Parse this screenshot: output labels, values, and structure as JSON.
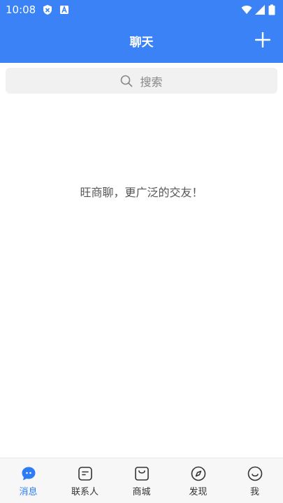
{
  "status_bar": {
    "time": "10:08",
    "icons": [
      "shield-notification-icon",
      "a-notification-icon",
      "wifi-icon",
      "signal-icon",
      "battery-icon"
    ]
  },
  "header": {
    "title": "聊天",
    "add_icon": "plus-icon",
    "background_color": "#3a82f6"
  },
  "search": {
    "placeholder": "搜索",
    "icon": "search-icon"
  },
  "empty_state": {
    "text": "旺商聊，更广泛的交友！"
  },
  "tab_bar": {
    "active_color": "#2d7cf6",
    "tabs": [
      {
        "label": "消息",
        "icon": "chat-bubble-icon",
        "active": true
      },
      {
        "label": "联系人",
        "icon": "contacts-icon",
        "active": false
      },
      {
        "label": "商城",
        "icon": "shopping-bag-icon",
        "active": false
      },
      {
        "label": "发现",
        "icon": "compass-icon",
        "active": false
      },
      {
        "label": "我",
        "icon": "smiley-icon",
        "active": false
      }
    ]
  }
}
